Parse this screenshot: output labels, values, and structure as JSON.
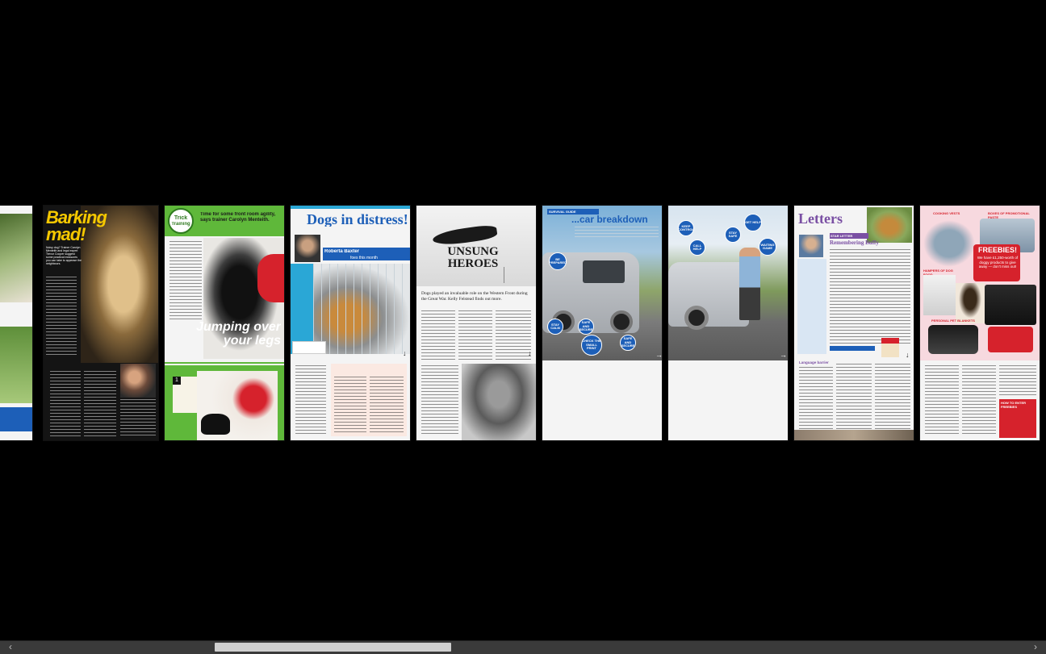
{
  "pages": {
    "barking": {
      "title": "Barking mad!",
      "intro": "Noisy dog? Trainer Carolyn Menteith and legal expert Trevor Cooper suggest some practical measures you can take to appease the neighbours."
    },
    "trick": {
      "logo_word": "Trick",
      "logo_word2": "Training",
      "strap": "Time for some front room agility, says trainer Carolyn Menteith.",
      "headline": "Jumping over your legs",
      "step_number": "1"
    },
    "distress": {
      "title": "Dogs in distress!",
      "strap": "Roberta Baxter",
      "strap_tail": "foes this month"
    },
    "heroes": {
      "title": "UNSUNG HEROES",
      "deck": "Dogs played an invaluable role on the Western Front during the Great War. Kelly Felstead finds out more.",
      "subhead": "UNCONTAINED HISTORY"
    },
    "breakdown": {
      "kicker": "SURVIVAL GUIDE",
      "title": "...car breakdown",
      "badges": [
        "BE PREPARED",
        "STAY CALM",
        "SAFE AND SECURE",
        "CHECK THE SMALL PRINT",
        "SAFE AND SECURE"
      ]
    },
    "breakdown2": {
      "badges": [
        "KEEP CONTROL",
        "CALL HELP",
        "GET HELP",
        "STAY SAFE",
        "WAITING GAME"
      ]
    },
    "letters": {
      "title": "Letters",
      "tag": "STAR LETTER",
      "heading": "Remembering Buffy",
      "subhead": "Language barrier"
    },
    "freebies": {
      "title": "FREEBIES!",
      "body": "We have £1,250-worth of doggy products to give away — don't miss out!",
      "label1": "COOKING VESTS",
      "label2": "BOXES OF PROMOTIONAL PASTE",
      "label3": "HAMPERS OF DOG FOOD",
      "label4": "PERSONAL PET BLANKETS",
      "label5": "HOW TO ENTER FREEBIES"
    }
  },
  "scrollbar": {
    "left_arrow": "‹",
    "right_arrow": "›"
  },
  "colors": {
    "background": "#000000",
    "green_brand": "#5fb83a",
    "blue_brand": "#1d5fb8",
    "red_brand": "#d6222c",
    "yellow_title": "#f5c800"
  }
}
